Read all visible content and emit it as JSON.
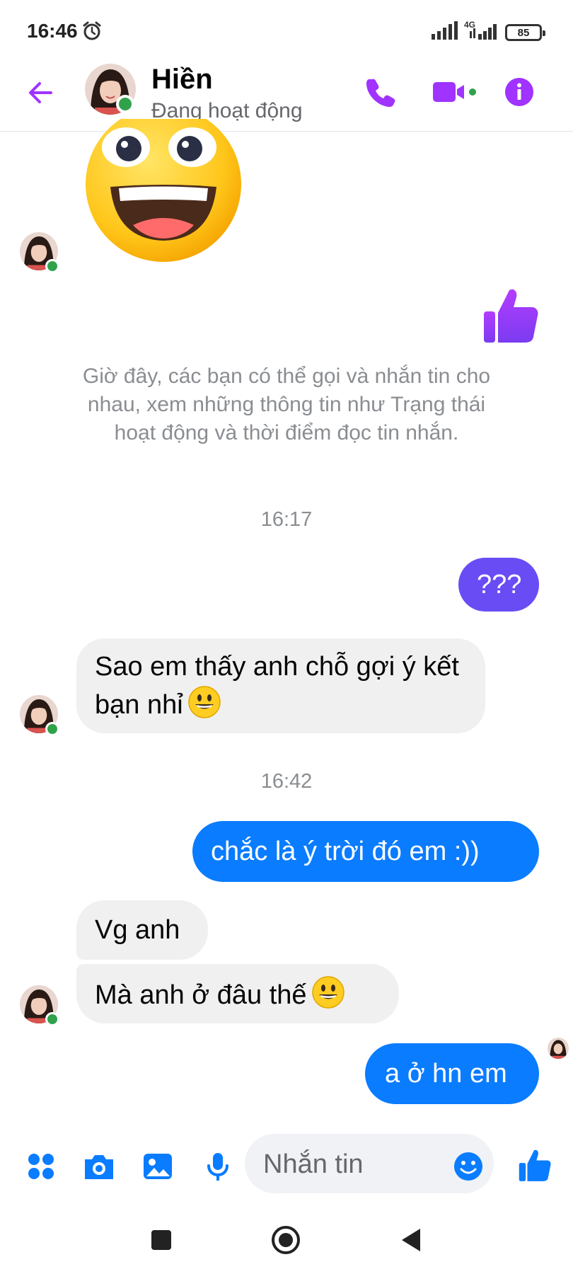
{
  "status_bar": {
    "time": "16:46",
    "network": "4G",
    "battery": "85"
  },
  "header": {
    "contact_name": "Hiền",
    "contact_status": "Đang hoạt động"
  },
  "conversation": {
    "system_message": "Giờ đây, các bạn có thể gọi và nhắn tin cho nhau, xem những thông tin như Trạng thái hoạt động và thời điểm đọc tin nhắn.",
    "timestamp_1": "16:17",
    "msg_out_1": "???",
    "msg_in_1": "Sao em thấy anh chỗ gợi ý kết bạn nhỉ",
    "timestamp_2": "16:42",
    "msg_out_2": "chắc là ý trời đó em :))",
    "msg_in_2": "Vg anh",
    "msg_in_3": "Mà anh ở đâu thế",
    "msg_out_3": "a ở hn em"
  },
  "composer": {
    "placeholder": "Nhắn tin"
  },
  "colors": {
    "accent_purple": "#a033ff",
    "bubble_purple": "#6a4cf5",
    "bubble_blue": "#0a7cff",
    "icon_blue": "#0a7cff",
    "online_green": "#31a24c"
  },
  "icons": [
    "back-arrow-icon",
    "phone-icon",
    "video-camera-icon",
    "info-icon",
    "thumbs-up-icon",
    "menu-grid-icon",
    "camera-icon",
    "image-icon",
    "microphone-icon",
    "emoji-icon"
  ]
}
